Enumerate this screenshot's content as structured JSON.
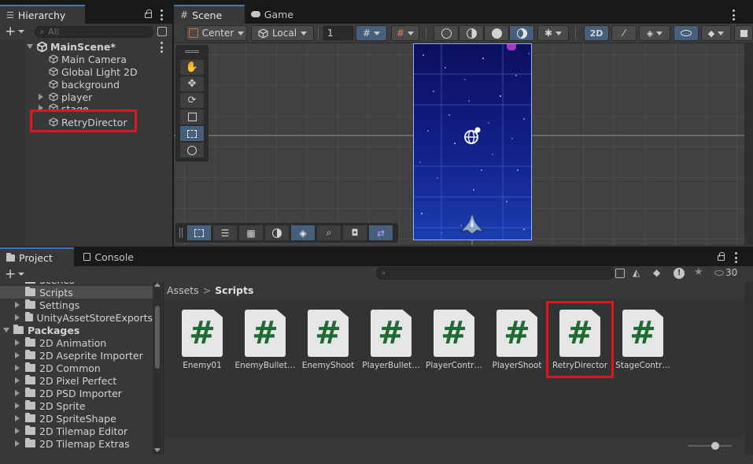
{
  "hierarchy": {
    "tab_label": "Hierarchy",
    "add_label": "+",
    "search_placeholder": "All",
    "scene": "MainScene*",
    "items": [
      {
        "label": "Main Camera",
        "expandable": false
      },
      {
        "label": "Global Light 2D",
        "expandable": false
      },
      {
        "label": "background",
        "expandable": false
      },
      {
        "label": "player",
        "expandable": true
      },
      {
        "label": "stage",
        "expandable": true
      },
      {
        "label": "RetryDirector",
        "expandable": false,
        "highlighted": true
      }
    ]
  },
  "scene_view": {
    "tabs": [
      {
        "label": "Scene",
        "icon": "grid-icon"
      },
      {
        "label": "Game",
        "icon": "gamepad-icon"
      }
    ],
    "pivot_mode": "Center",
    "pivot_rotation": "Local",
    "grid_snap_value": "1",
    "mode_2d_label": "2D"
  },
  "project": {
    "tabs": [
      "Project",
      "Console"
    ],
    "add_label": "+",
    "search_placeholder": "",
    "hidden_count": "30",
    "tree": [
      {
        "label": "Scenes",
        "indent": 1,
        "arrow": false
      },
      {
        "label": "Scripts",
        "indent": 1,
        "arrow": false,
        "selected": true
      },
      {
        "label": "Settings",
        "indent": 1,
        "arrow": true
      },
      {
        "label": "UnityAssetStoreExports",
        "indent": 1,
        "arrow": true
      },
      {
        "label": "Packages",
        "indent": 0,
        "arrow": "down",
        "bold": true
      },
      {
        "label": "2D Animation",
        "indent": 1,
        "arrow": true
      },
      {
        "label": "2D Aseprite Importer",
        "indent": 1,
        "arrow": true
      },
      {
        "label": "2D Common",
        "indent": 1,
        "arrow": true
      },
      {
        "label": "2D Pixel Perfect",
        "indent": 1,
        "arrow": true
      },
      {
        "label": "2D PSD Importer",
        "indent": 1,
        "arrow": true
      },
      {
        "label": "2D Sprite",
        "indent": 1,
        "arrow": true
      },
      {
        "label": "2D SpriteShape",
        "indent": 1,
        "arrow": true
      },
      {
        "label": "2D Tilemap Editor",
        "indent": 1,
        "arrow": true
      },
      {
        "label": "2D Tilemap Extras",
        "indent": 1,
        "arrow": true
      }
    ],
    "breadcrumb": {
      "root": "Assets",
      "separator": ">",
      "current": "Scripts"
    },
    "assets": [
      {
        "name": "Enemy01",
        "glyph": "#"
      },
      {
        "name": "EnemyBullet…",
        "glyph": "#"
      },
      {
        "name": "EnemyShoot",
        "glyph": "#"
      },
      {
        "name": "PlayerBullet…",
        "glyph": "#"
      },
      {
        "name": "PlayerContr…",
        "glyph": "#"
      },
      {
        "name": "PlayerShoot",
        "glyph": "#"
      },
      {
        "name": "RetryDirector",
        "glyph": "#",
        "highlighted": true
      },
      {
        "name": "StageContr…",
        "glyph": "#"
      }
    ]
  },
  "colors": {
    "accent": "#3a79bb",
    "highlight": "#e0161f",
    "script_hash": "#1f6b34",
    "sky": "#10176b"
  }
}
